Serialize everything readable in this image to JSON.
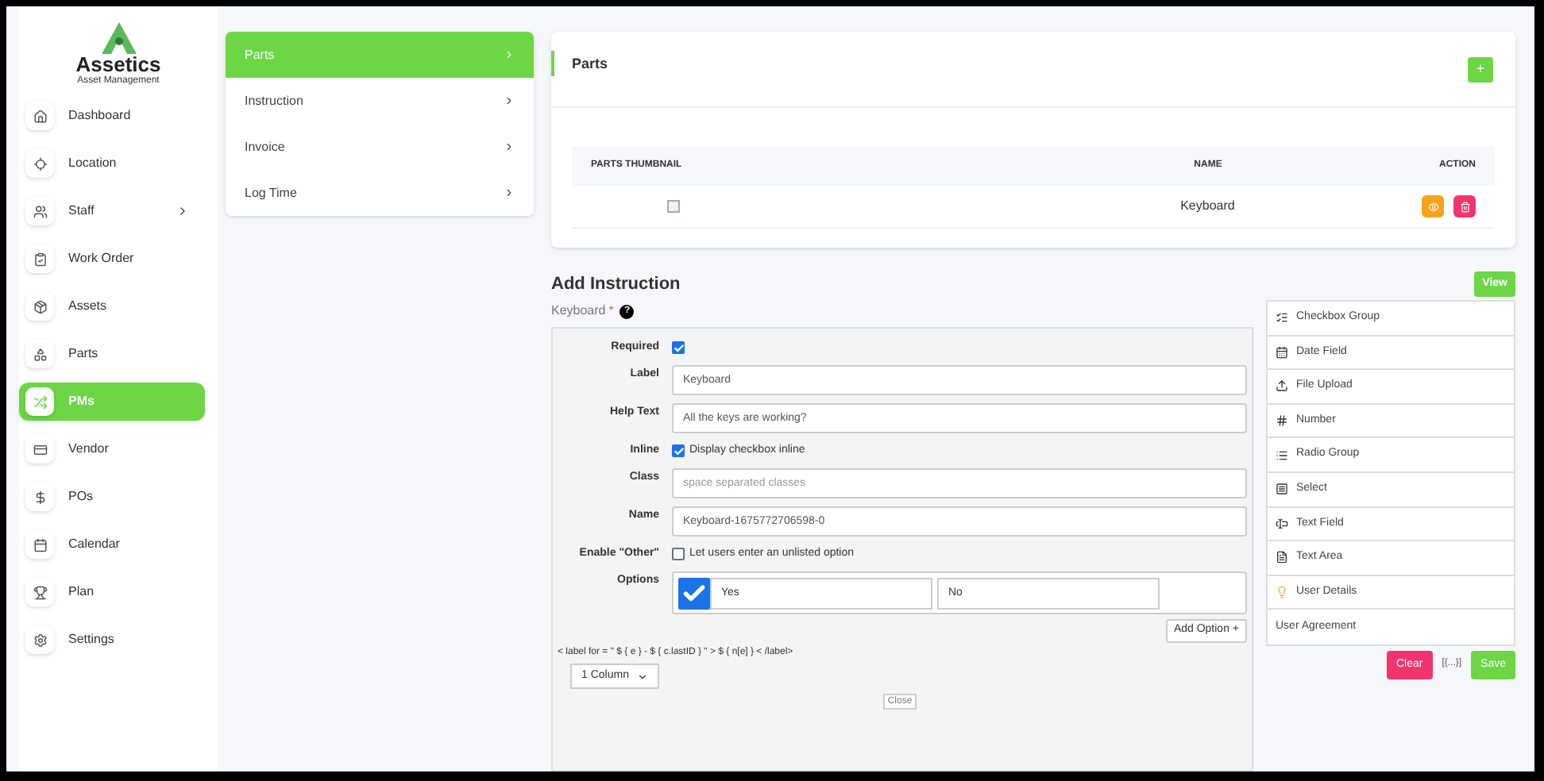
{
  "brand": {
    "name": "Assetics",
    "tagline": "Asset Management"
  },
  "sidebar": {
    "items": [
      {
        "label": "Dashboard",
        "selected": false,
        "has_submenu": false
      },
      {
        "label": "Location",
        "selected": false,
        "has_submenu": false
      },
      {
        "label": "Staff",
        "selected": false,
        "has_submenu": true
      },
      {
        "label": "Work Order",
        "selected": false,
        "has_submenu": false
      },
      {
        "label": "Assets",
        "selected": false,
        "has_submenu": false
      },
      {
        "label": "Parts",
        "selected": false,
        "has_submenu": false
      },
      {
        "label": "PMs",
        "selected": true,
        "has_submenu": false
      },
      {
        "label": "Vendor",
        "selected": false,
        "has_submenu": false
      },
      {
        "label": "POs",
        "selected": false,
        "has_submenu": false
      },
      {
        "label": "Calendar",
        "selected": false,
        "has_submenu": false
      },
      {
        "label": "Plan",
        "selected": false,
        "has_submenu": false
      },
      {
        "label": "Settings",
        "selected": false,
        "has_submenu": false
      }
    ]
  },
  "submenu": {
    "items": [
      {
        "label": "Parts",
        "selected": true
      },
      {
        "label": "Instruction",
        "selected": false
      },
      {
        "label": "Invoice",
        "selected": false
      },
      {
        "label": "Log Time",
        "selected": false
      }
    ]
  },
  "parts_card": {
    "title": "Parts",
    "add_button": "+",
    "table": {
      "columns": [
        "PARTS THUMBNAIL",
        "NAME",
        "ACTION"
      ],
      "rows": [
        {
          "name": "Keyboard"
        }
      ]
    }
  },
  "instruction": {
    "title": "Add Instruction",
    "view_button": "View",
    "field_title": "Keyboard",
    "required_mark": "*",
    "help_icon": "?",
    "fields": [
      {
        "kind": "checkbox",
        "label": "Required",
        "checked": true
      },
      {
        "kind": "text",
        "label": "Label",
        "value": "Keyboard"
      },
      {
        "kind": "text",
        "label": "Help Text",
        "value": "All the keys are working?"
      },
      {
        "kind": "checkbox",
        "label": "Inline",
        "checked": true,
        "text": "Display checkbox inline"
      },
      {
        "kind": "text",
        "label": "Class",
        "placeholder": "space separated classes"
      },
      {
        "kind": "text",
        "label": "Name",
        "value": "Keyboard-1675772706598-0"
      },
      {
        "kind": "checkbox",
        "label": "Enable \"Other\"",
        "checked": false,
        "text": "Let users enter an unlisted option"
      },
      {
        "kind": "options",
        "label": "Options",
        "options": [
          {
            "value": "Yes",
            "checked": true
          },
          {
            "value": "No",
            "checked": false
          }
        ]
      }
    ],
    "add_option": "Add Option +",
    "template": "< label for = \" $ { e } - $ { c.lastID } \" > $ { n[e] } < /label>",
    "columns_select": "1 Column",
    "close_button": "Close"
  },
  "palette": {
    "items": [
      "Checkbox Group",
      "Date Field",
      "File Upload",
      "Number",
      "Radio Group",
      "Select",
      "Text Field",
      "Text Area",
      "User Details",
      "User Agreement"
    ],
    "clear_button": "Clear",
    "data_button": "[{...}]",
    "save_button": "Save"
  }
}
